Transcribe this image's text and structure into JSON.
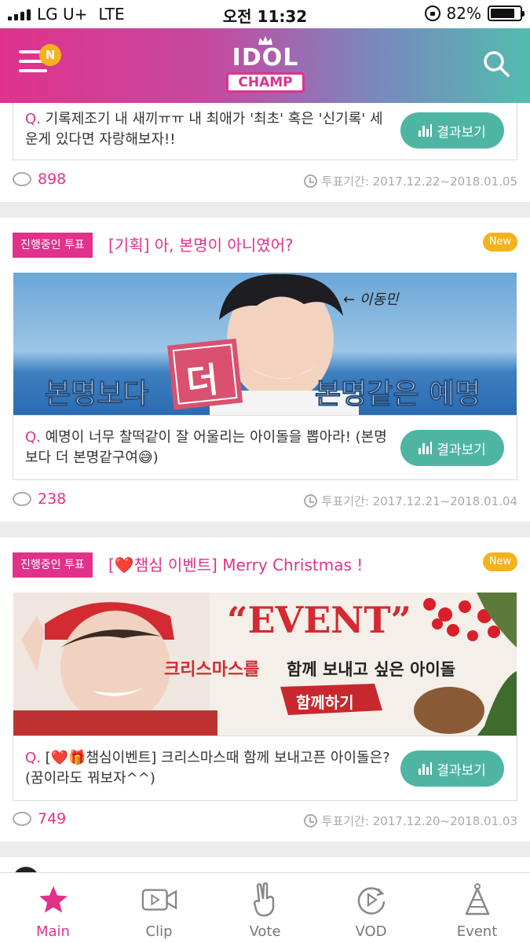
{
  "status_bar": {
    "carrier": "LG U+",
    "network": "LTE",
    "time": "오전 11:32",
    "battery": "82%",
    "battery_level": 0.82
  },
  "header": {
    "menu_badge": "N",
    "logo_line1": "IDOL",
    "logo_line2": "CHAMP"
  },
  "colors": {
    "brand_pink": "#e0328b",
    "teal": "#4fb5a3",
    "badge_yellow": "#f5b21c"
  },
  "cards": [
    {
      "question_prefix": "Q.",
      "question": "기록제조기 내 새끼ㅠㅠ 내 최애가 '최초' 혹은 '신기록' 세운게 있다면 자랑해보자!!",
      "result_label": "결과보기",
      "comments": "898",
      "period": "투표기간: 2017.12.22~2018.01.05"
    },
    {
      "tag": "진행중인 투표",
      "title": "[기획] 아, 본명이 아니였어?",
      "new_label": "New",
      "banner": {
        "text_left": "본명보다",
        "text_mid": "더",
        "text_right": "본명같은 예명",
        "handwriting": "← 이동민"
      },
      "question_prefix": "Q.",
      "question": "예명이 너무 찰떡같이 잘 어울리는 아이돌을 뽑아라! (본명보다 더 본명같구여😅)",
      "result_label": "결과보기",
      "comments": "238",
      "period": "투표기간: 2017.12.21~2018.01.04"
    },
    {
      "tag": "진행중인 투표",
      "title": "[❤️챔심 이벤트] Merry Christmas !",
      "new_label": "New",
      "banner": {
        "event": "“EVENT”",
        "line2a": "크리스마스를",
        "line2b": "함께 보내고 싶은 아이돌",
        "ribbon": "함께하기"
      },
      "question_prefix": "Q.",
      "question": "[❤️🎁챔심이벤트] 크리스마스때 함께 보내고픈 아이돌은? (꿈이라도 꿔보자^^)",
      "result_label": "결과보기",
      "comments": "749",
      "period": "투표기간: 2017.12.20~2018.01.03"
    }
  ],
  "tabs": [
    {
      "label": "Main",
      "icon": "star-icon",
      "active": true
    },
    {
      "label": "Clip",
      "icon": "video-icon",
      "active": false
    },
    {
      "label": "Vote",
      "icon": "hand-icon",
      "active": false
    },
    {
      "label": "VOD",
      "icon": "replay-icon",
      "active": false
    },
    {
      "label": "Event",
      "icon": "party-hat-icon",
      "active": false
    }
  ]
}
